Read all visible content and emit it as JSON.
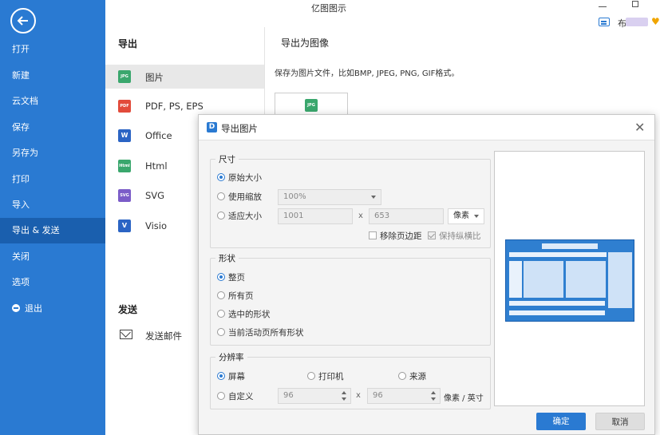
{
  "window": {
    "title": "亿图图示",
    "user_initial": "布"
  },
  "sidebar": {
    "items": [
      "打开",
      "新建",
      "云文档",
      "保存",
      "另存为",
      "打印",
      "导入",
      "导出 & 发送",
      "关闭",
      "选项",
      "退出"
    ]
  },
  "export_col": {
    "export_heading": "导出",
    "items": [
      "图片",
      "PDF, PS, EPS",
      "Office",
      "Html",
      "SVG",
      "Visio"
    ],
    "send_heading": "发送",
    "send_mail": "发送邮件"
  },
  "content": {
    "heading": "导出为图像",
    "description": "保存为图片文件，比如BMP, JPEG, PNG, GIF格式。"
  },
  "file_icons": {
    "jpg": "JPG",
    "pdf": "PDF",
    "word": "W",
    "html": "Html",
    "svg": "SVG",
    "visio": "V"
  },
  "dialog": {
    "title": "导出图片",
    "size": {
      "legend": "尺寸",
      "original": "原始大小",
      "use_scale": "使用缩放",
      "scale_value": "100%",
      "fit_size": "适应大小",
      "width": "1001",
      "height": "653",
      "times": "x",
      "unit": "像素",
      "remove_margin": "移除页边距",
      "keep_ratio": "保持纵横比"
    },
    "shape": {
      "legend": "形状",
      "full_page": "整页",
      "all_pages": "所有页",
      "selected": "选中的形状",
      "active_page_shapes": "当前活动页所有形状"
    },
    "resolution": {
      "legend": "分辨率",
      "screen": "屏幕",
      "printer": "打印机",
      "source": "来源",
      "custom": "自定义",
      "dpi_x": "96",
      "dpi_y": "96",
      "times": "x",
      "unit": "像素 / 英寸"
    },
    "ok": "确定",
    "cancel": "取消"
  },
  "colors": {
    "accent": "#2a7ad2",
    "sidebar_active": "#1a5fae"
  }
}
